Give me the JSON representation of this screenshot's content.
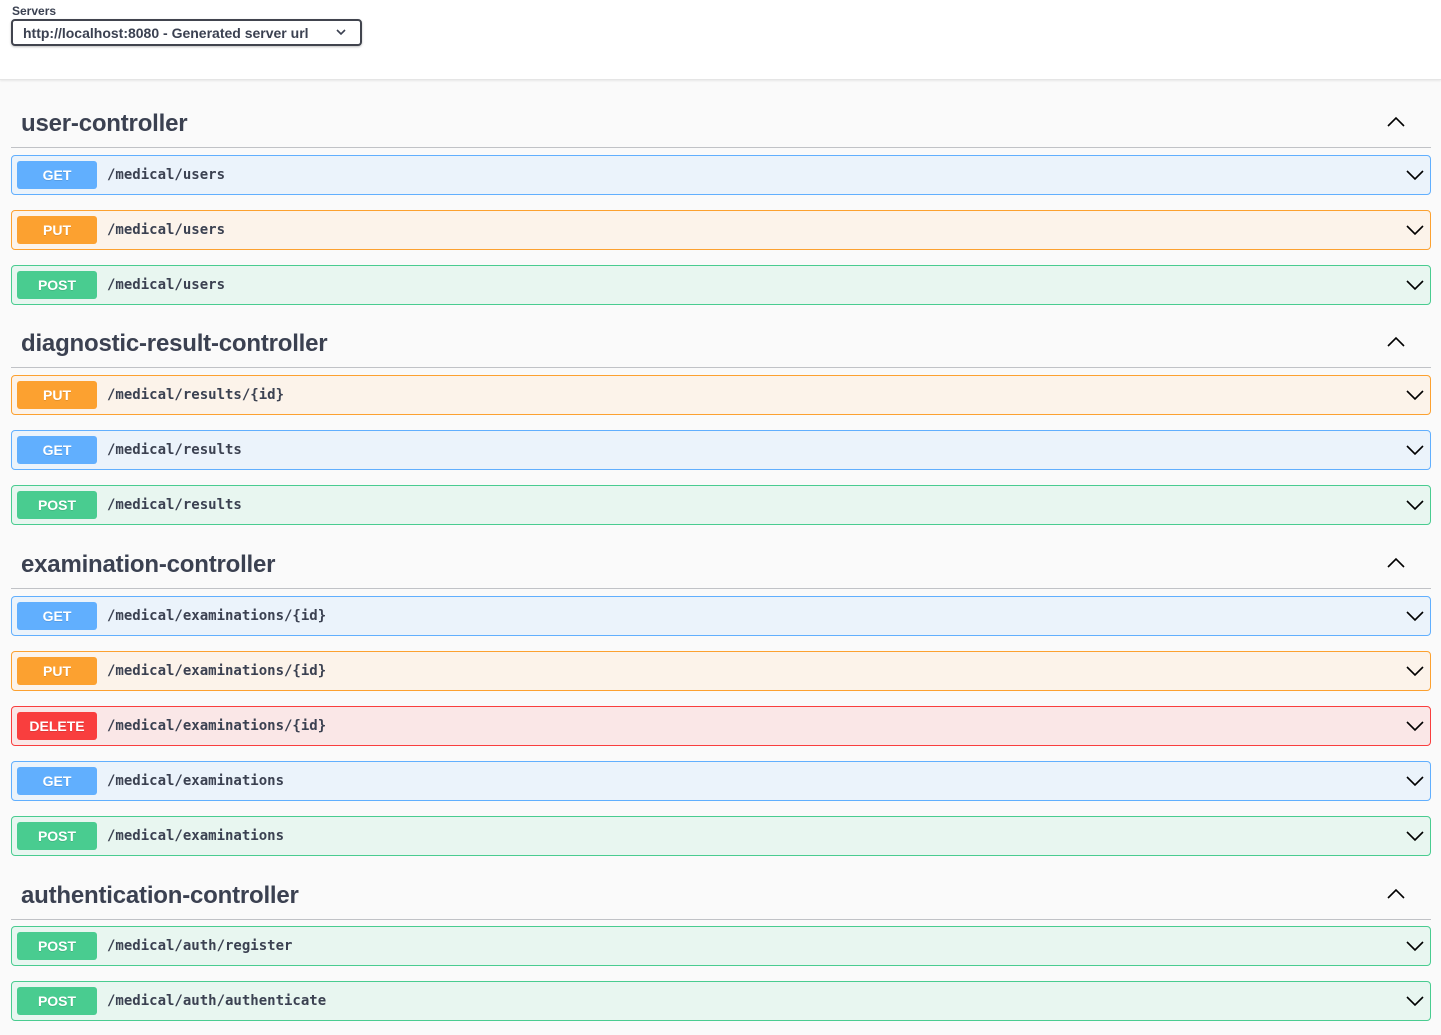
{
  "servers": {
    "label": "Servers",
    "selected": "http://localhost:8080 - Generated server url"
  },
  "tags": [
    {
      "name": "user-controller",
      "operations": [
        {
          "method": "GET",
          "path": "/medical/users"
        },
        {
          "method": "PUT",
          "path": "/medical/users"
        },
        {
          "method": "POST",
          "path": "/medical/users"
        }
      ]
    },
    {
      "name": "diagnostic-result-controller",
      "operations": [
        {
          "method": "PUT",
          "path": "/medical/results/{id}"
        },
        {
          "method": "GET",
          "path": "/medical/results"
        },
        {
          "method": "POST",
          "path": "/medical/results"
        }
      ]
    },
    {
      "name": "examination-controller",
      "operations": [
        {
          "method": "GET",
          "path": "/medical/examinations/{id}"
        },
        {
          "method": "PUT",
          "path": "/medical/examinations/{id}"
        },
        {
          "method": "DELETE",
          "path": "/medical/examinations/{id}"
        },
        {
          "method": "GET",
          "path": "/medical/examinations"
        },
        {
          "method": "POST",
          "path": "/medical/examinations"
        }
      ]
    },
    {
      "name": "authentication-controller",
      "operations": [
        {
          "method": "POST",
          "path": "/medical/auth/register"
        },
        {
          "method": "POST",
          "path": "/medical/auth/authenticate"
        }
      ]
    }
  ],
  "colors": {
    "GET": "#61affe",
    "PUT": "#fca130",
    "POST": "#49cc90",
    "DELETE": "#f93e3e"
  }
}
